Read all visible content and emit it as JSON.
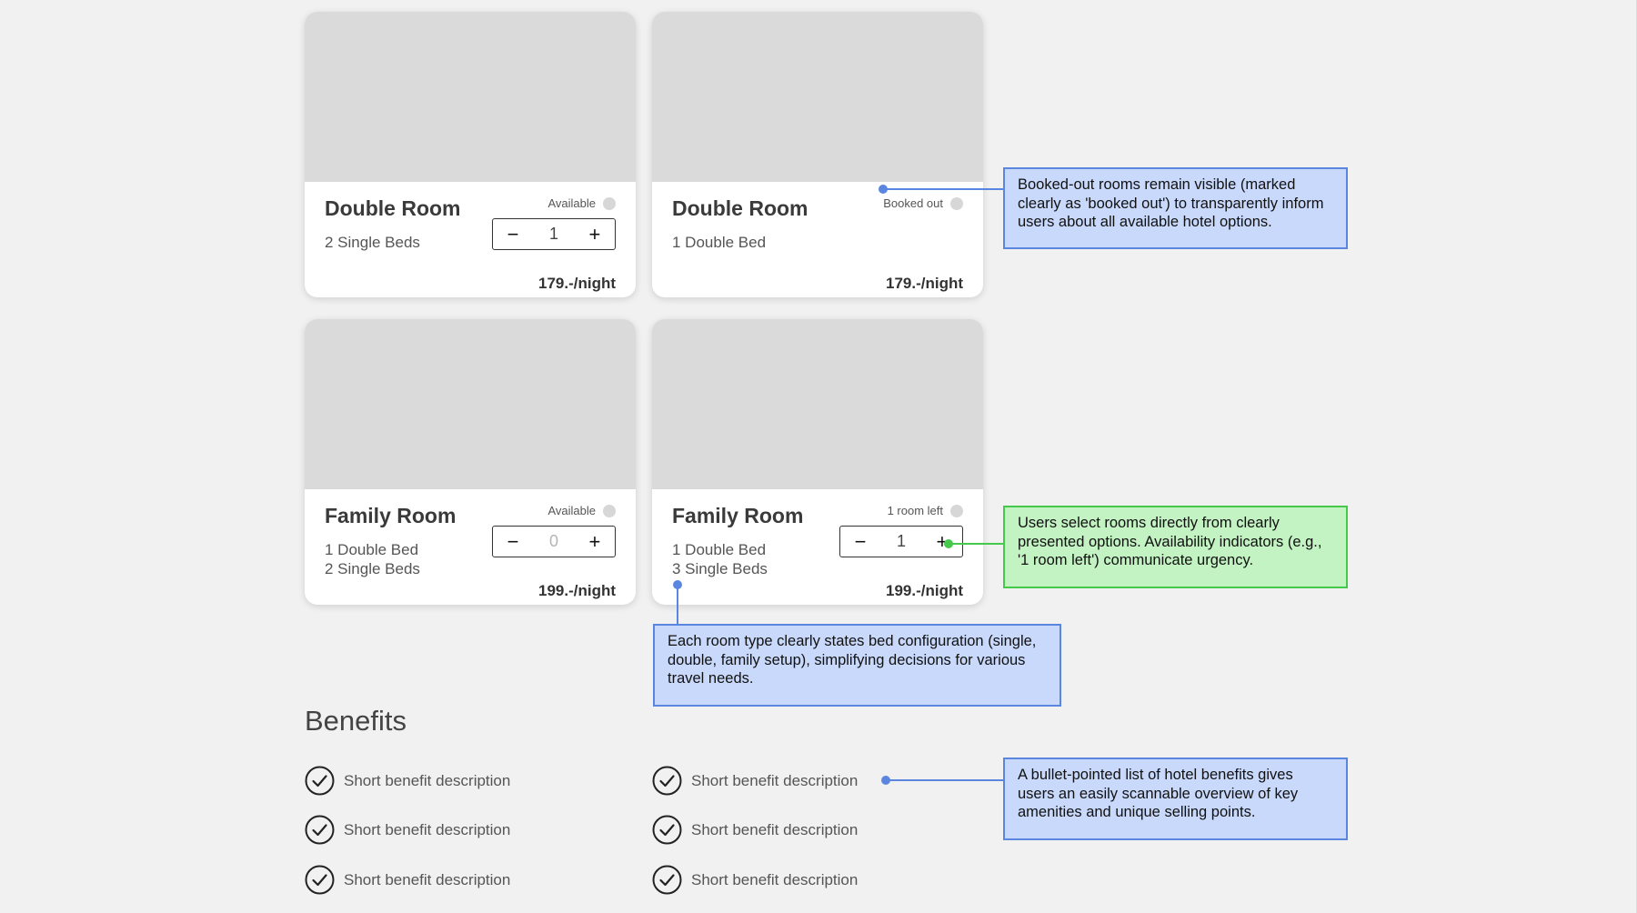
{
  "rooms": [
    {
      "title": "Double Room",
      "beds": [
        "2 Single Beds"
      ],
      "status": "Available",
      "quantity": "1",
      "price": "179.-/night",
      "stepper": true,
      "zero": false
    },
    {
      "title": "Double Room",
      "beds": [
        "1 Double Bed"
      ],
      "status": "Booked out",
      "price": "179.-/night",
      "stepper": false
    },
    {
      "title": "Family Room",
      "beds": [
        "1 Double Bed",
        "2 Single Beds"
      ],
      "status": "Available",
      "quantity": "0",
      "price": "199.-/night",
      "stepper": true,
      "zero": true
    },
    {
      "title": "Family Room",
      "beds": [
        "1 Double Bed",
        "3 Single Beds"
      ],
      "status": "1 room left",
      "quantity": "1",
      "price": "199.-/night",
      "stepper": true,
      "zero": false
    }
  ],
  "stepper": {
    "minus": "−",
    "plus": "+"
  },
  "annotations": {
    "booked_out": "Booked-out rooms remain visible (marked clearly as 'booked out') to transparently inform users about all available hotel options.",
    "select": "Users select rooms directly from clearly presented options. Availability indicators (e.g., '1 room left') communicate urgency.",
    "bed_config": "Each room type clearly states bed configuration (single, double, family setup), simplifying decisions for various travel needs.",
    "benefits": "A bullet-pointed list of hotel benefits gives users an easily scannable overview of key amenities and unique selling points."
  },
  "benefits": {
    "title": "Benefits",
    "items": [
      "Short benefit description",
      "Short benefit description",
      "Short benefit description",
      "Short benefit description",
      "Short benefit description",
      "Short benefit description"
    ]
  },
  "colors": {
    "note_blue_bg": "#c9d9fb",
    "note_blue_border": "#5b86e0",
    "note_green_bg": "#c3f2c3",
    "note_green_border": "#45c94b",
    "status_dot": "#d7d7d7"
  },
  "icons": {
    "benefit": "check-circle-icon",
    "status": "status-dot-icon"
  }
}
